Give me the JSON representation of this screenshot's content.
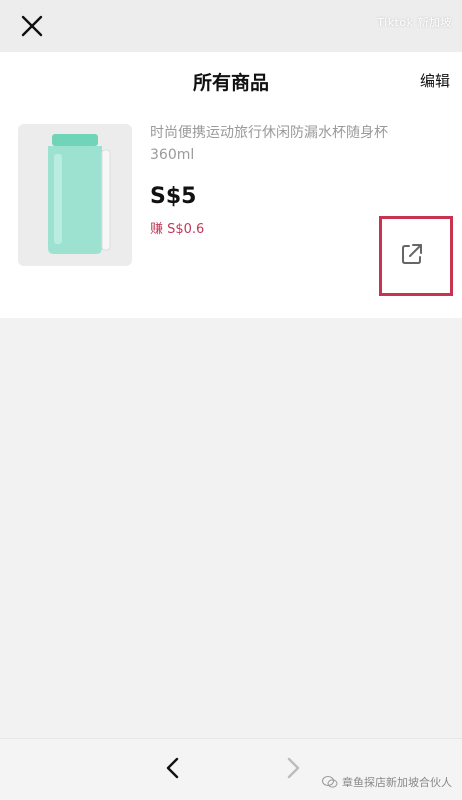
{
  "top_bar": {
    "status_text": "Tiktok 新加坡"
  },
  "header": {
    "title": "所有商品",
    "edit_label": "编辑"
  },
  "product": {
    "name": "时尚便携运动旅行休闲防漏水杯随身杯360ml",
    "price": "S$5",
    "earn": "赚 S$0.6",
    "image_icon": "water-bottle-icon"
  },
  "bottom_bar": {
    "watermark": "章鱼探店新加坡合伙人"
  },
  "colors": {
    "highlight": "#c8344f",
    "earn_text": "#c03a5a",
    "bottle": "#7fd9c2"
  }
}
